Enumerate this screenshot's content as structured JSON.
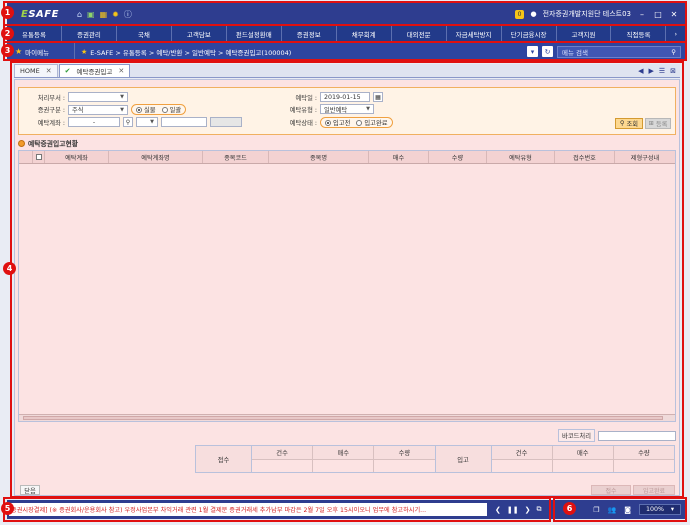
{
  "titlebar": {
    "logo_prefix": "E",
    "logo_rest": "SAFE",
    "bell_count": "0",
    "user_label": "전자증권개발지원단 테스트03"
  },
  "menu": [
    "유통등록",
    "증권관리",
    "국채",
    "고객담보",
    "펀드설정환매",
    "증권정보",
    "채무회계",
    "대외전문",
    "자금세탁방지",
    "단기금융시장",
    "고객지원",
    "직접등록"
  ],
  "crumbbar": {
    "mymenu": "마이메뉴",
    "path": "E-SAFE > 유통등록 > 예탁/반환 > 일반예탁 > 예탁증권입고(100004)",
    "search_label": "메뉴 검색"
  },
  "tabs": [
    {
      "label": "HOME",
      "active": false
    },
    {
      "label": "예탁증권입고",
      "active": true
    }
  ],
  "filter": {
    "dept_label": "처리부서 :",
    "dept_value": "",
    "sec_type_label": "증권구분 :",
    "sec_type_value": "주식",
    "issue_type_options": [
      "실물",
      "일괄"
    ],
    "issue_type_selected": "실물",
    "account_label": "예탁계좌 :",
    "account_value": "-",
    "date_label": "예탁일 :",
    "date_value": "2019-01-15",
    "deposit_type_label": "예탁유형 :",
    "deposit_type_value": "일반예탁",
    "status_label": "예탁상태 :",
    "status_options": [
      "입고전",
      "입고완료"
    ],
    "status_selected": "입고전",
    "search_button": "조회",
    "register_button": "등록"
  },
  "grid": {
    "title": "예탁증권입고현황",
    "columns": [
      "예탁계좌",
      "예탁계좌명",
      "종목코드",
      "종목명",
      "매수",
      "수량",
      "예탁유형",
      "접수번호",
      "제형구성내"
    ]
  },
  "barcode_label": "바코드처리",
  "summary": {
    "receipt_label": "접수",
    "inbound_label": "입고",
    "cols": [
      "건수",
      "매수",
      "수량"
    ]
  },
  "close_button": "닫음",
  "disabled_buttons": [
    "접수",
    "입고완료"
  ],
  "ticker_text": "증권시장결제] (※ 증권회사/운용회사 참고) 우정사업본부 차익거래 관련 1월 결제분 증권거래세 추가납부 마감은 2월 7일 오후 15시이오니 업무에 참고하시기...",
  "zoom": "100%",
  "annotations": [
    "1",
    "2",
    "3",
    "4",
    "5",
    "6"
  ]
}
